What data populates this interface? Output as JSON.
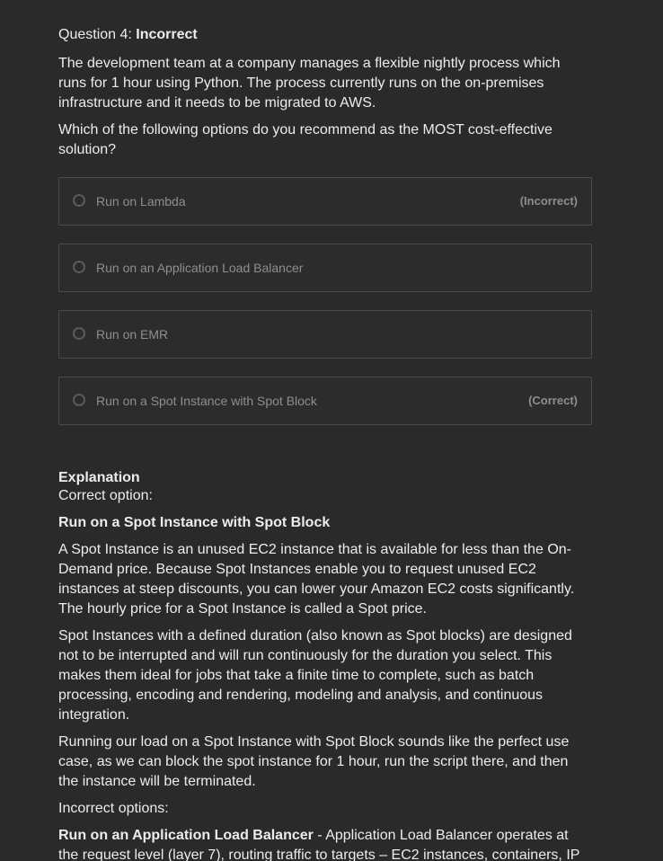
{
  "question": {
    "prefix": "Question 4: ",
    "status": "Incorrect",
    "paragraphs": [
      "The development team at a company manages a flexible nightly process which runs for 1 hour using Python. The process currently runs on the on-premises infrastructure and it needs to be migrated to AWS.",
      "Which of the following options do you recommend as the MOST cost-effective solution?"
    ]
  },
  "options": [
    {
      "label": "Run on Lambda",
      "mark": "(Incorrect)"
    },
    {
      "label": "Run on an Application Load Balancer",
      "mark": ""
    },
    {
      "label": "Run on EMR",
      "mark": ""
    },
    {
      "label": "Run on a Spot Instance with Spot Block",
      "mark": "(Correct)"
    }
  ],
  "explanation": {
    "heading": "Explanation",
    "correct_intro": "Correct option:",
    "correct_title": "Run on a Spot Instance with Spot Block",
    "paragraphs": [
      "A Spot Instance is an unused EC2 instance that is available for less than the On-Demand price. Because Spot Instances enable you to request unused EC2 instances at steep discounts, you can lower your Amazon EC2 costs significantly. The hourly price for a Spot Instance is called a Spot price.",
      "Spot Instances with a defined duration (also known as Spot blocks) are designed not to be interrupted and will run continuously for the duration you select. This makes them ideal for jobs that take a finite time to complete, such as batch processing, encoding and rendering, modeling and analysis, and continuous integration.",
      "Running our load on a Spot Instance with Spot Block sounds like the perfect use case, as we can block the spot instance for 1 hour, run the script there, and then the instance will be terminated."
    ],
    "incorrect_intro": "Incorrect options:",
    "incorrect_title": "Run on an Application Load Balancer",
    "incorrect_text": " - Application Load Balancer operates at the request level (layer 7), routing traffic to targets – EC2 instances, containers, IP"
  }
}
